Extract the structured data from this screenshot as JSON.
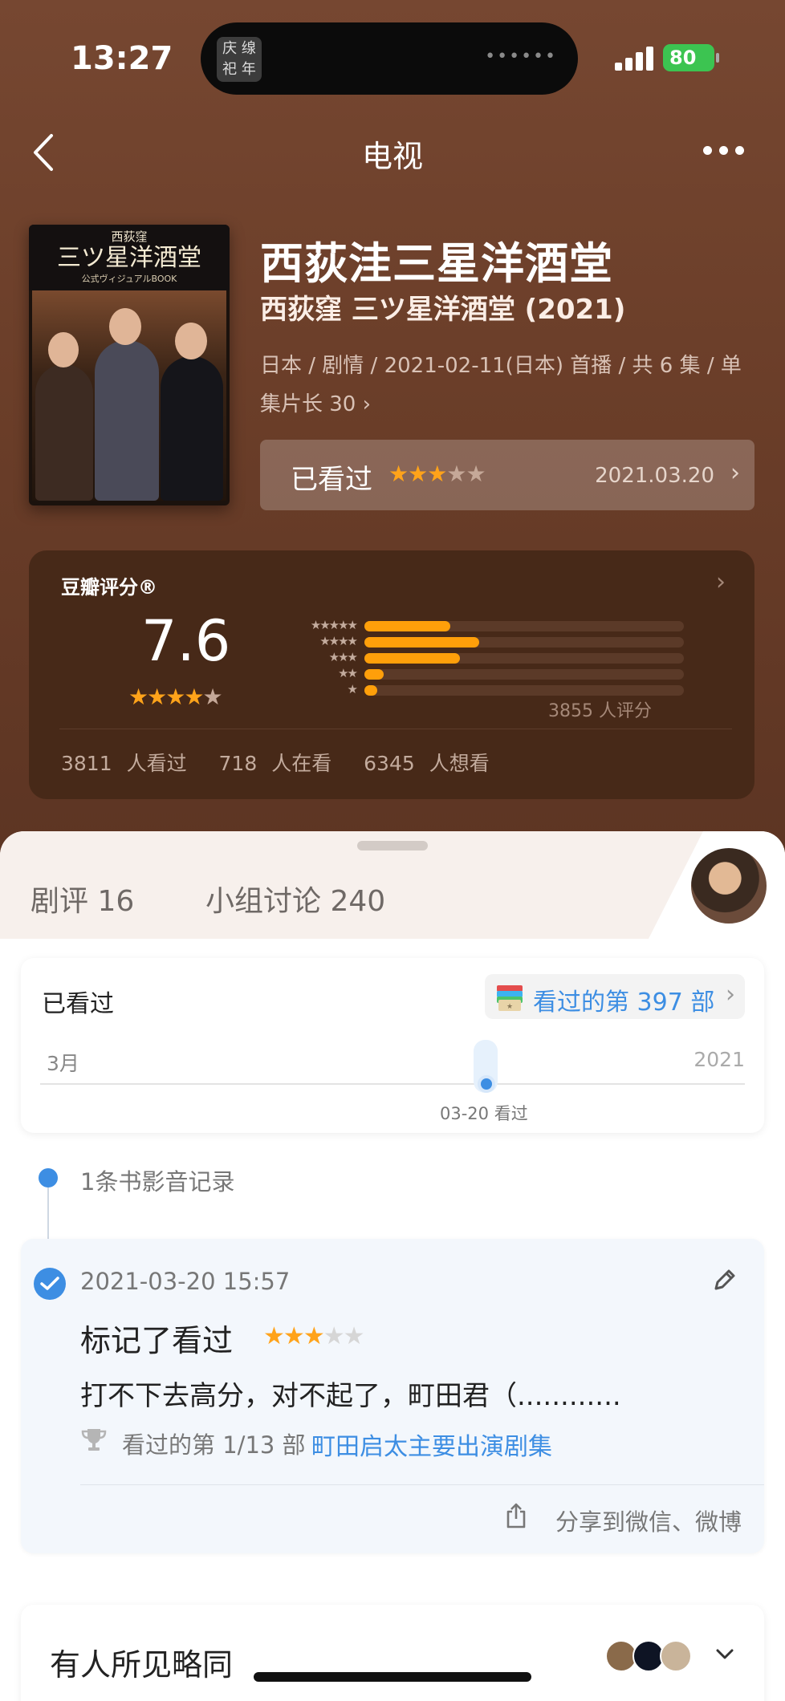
{
  "status_bar": {
    "time": "13:27",
    "battery": "80",
    "island_thumb": "庆 缐 祀 年"
  },
  "nav": {
    "title": "电视"
  },
  "movie": {
    "poster": {
      "line1": "西荻窪",
      "line2": "三ツ星洋酒堂",
      "line3": "公式ヴィジュアルBOOK"
    },
    "title": "西荻洼三星洋酒堂",
    "original_title": "西荻窪 三ツ星洋酒堂 (2021)",
    "meta": "日本 / 剧情 / 2021-02-11(日本) 首播 / 共 6 集 / 单集片长 30",
    "my_status": "已看过",
    "my_rating": 3,
    "my_date": "2021.03.20"
  },
  "rating": {
    "label": "豆瓣评分®",
    "score": "7.6",
    "stars": 4,
    "distribution": [
      0.27,
      0.36,
      0.3,
      0.06,
      0.04
    ],
    "count_text": "3855 人评分",
    "stats": [
      "3811 人看过",
      "718 人在看",
      "6345 人想看"
    ]
  },
  "tabs": [
    "剧评 16",
    "小组讨论 240"
  ],
  "watched_card": {
    "title": "已看过",
    "badge": "看过的第 397 部",
    "left_label": "3月",
    "right_label": "2021",
    "note": "03-20 看过"
  },
  "records": {
    "label": "1条书影音记录"
  },
  "entry": {
    "time": "2021-03-20 15:57",
    "mark": "标记了看过",
    "rating": 3,
    "comment": "打不下去高分，对不起了，町田君（............",
    "count": "看过的第 1/13 部",
    "link": "町田启太主要出演剧集",
    "share": "分享到微信、微博"
  },
  "peer": {
    "title": "有人所见略同"
  },
  "colors": {
    "accent": "#3d8ee3",
    "star": "#ffa31a",
    "header_bg": "#6b3e29"
  }
}
